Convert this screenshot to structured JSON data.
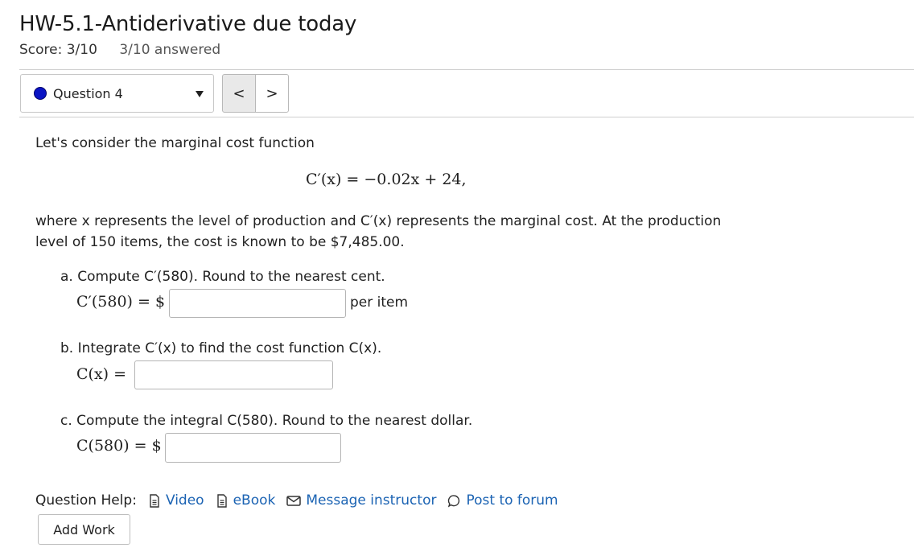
{
  "assignment": {
    "title": "HW-5.1-Antiderivative due today",
    "score": "Score: 3/10",
    "answered": "3/10 answered"
  },
  "nav": {
    "question_label": "Question 4",
    "prev_symbol": "<",
    "next_symbol": ">"
  },
  "question": {
    "intro": "Let's consider the marginal cost function",
    "formula": "C′(x) = −0.02x + 24,",
    "where_line1": "where x represents the level of production and C′(x) represents the marginal cost. At the production",
    "where_line2": "level of 150 items, the cost is known to be $7,485.00.",
    "part_a": {
      "prompt": "a. Compute C′(580). Round to the nearest cent.",
      "label": "C′(580) = $",
      "value": "",
      "unit": "per item"
    },
    "part_b": {
      "prompt": "b. Integrate C′(x) to find the cost function C(x).",
      "label": "C(x) =",
      "value": ""
    },
    "part_c": {
      "prompt": "c. Compute the integral C(580). Round to the nearest dollar.",
      "label": "C(580) = $",
      "value": ""
    }
  },
  "help": {
    "label": "Question Help:",
    "links": {
      "video": "Video",
      "ebook": "eBook",
      "message": "Message instructor",
      "forum": "Post to forum"
    }
  },
  "add_work_label": "Add Work",
  "colors": {
    "accent_link": "#1b63b3",
    "question_dot": "#0a14c4"
  }
}
